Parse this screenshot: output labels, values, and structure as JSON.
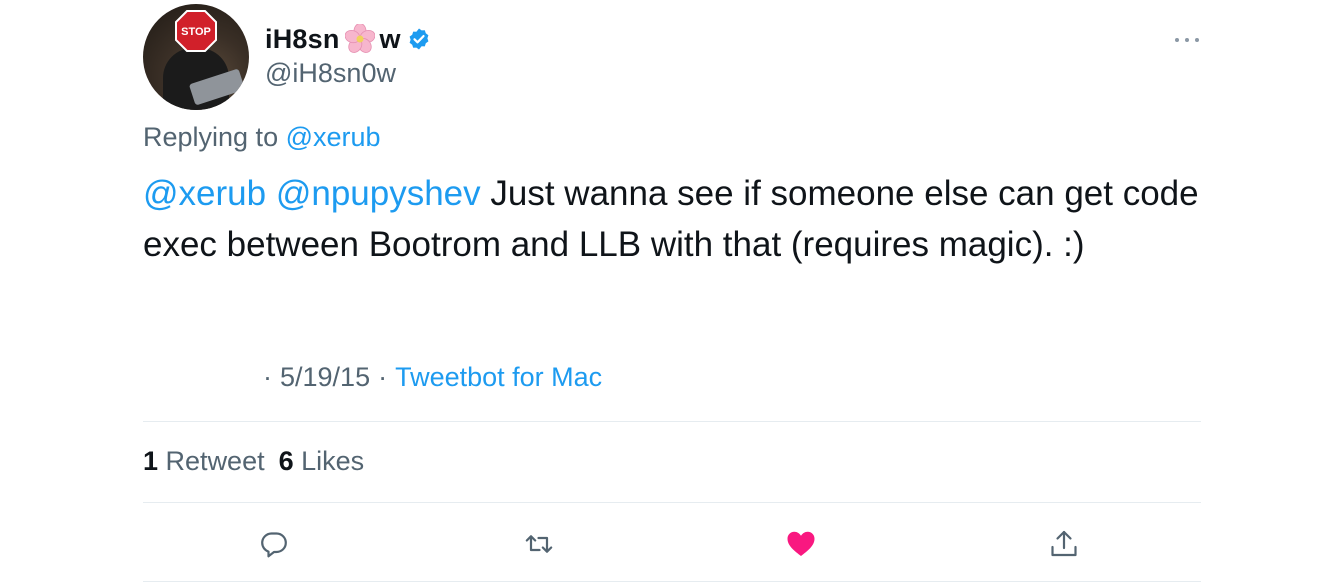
{
  "author": {
    "display_name_before": "iH8sn",
    "display_name_emoji": "cherry-blossom",
    "display_name_after": "w",
    "verified_icon": "verified-badge-icon",
    "handle": "@iH8sn0w",
    "avatar_sign_text": "STOP"
  },
  "reply": {
    "prefix": "Replying to ",
    "target": "@xerub"
  },
  "tweet": {
    "mention_1": "@xerub",
    "mention_2": "@npupyshev",
    "body": " Just wanna see if someone else can get code exec between Bootrom and LLB with that (requires magic). :)"
  },
  "meta": {
    "sep_1": "·",
    "date": "5/19/15",
    "sep_2": "·",
    "source": "Tweetbot for Mac"
  },
  "stats": {
    "retweets_count": "1",
    "retweets_label": "Retweet",
    "likes_count": "6",
    "likes_label": "Likes"
  },
  "actions": {
    "reply_icon": "reply-icon",
    "retweet_icon": "retweet-icon",
    "like_icon": "heart-icon",
    "share_icon": "share-icon",
    "like_color": "#f91880",
    "icon_color": "#536471"
  },
  "colors": {
    "link": "#1d9bf0",
    "text": "#0f1419",
    "secondary": "#536471",
    "verified": "#1d9bf0"
  }
}
